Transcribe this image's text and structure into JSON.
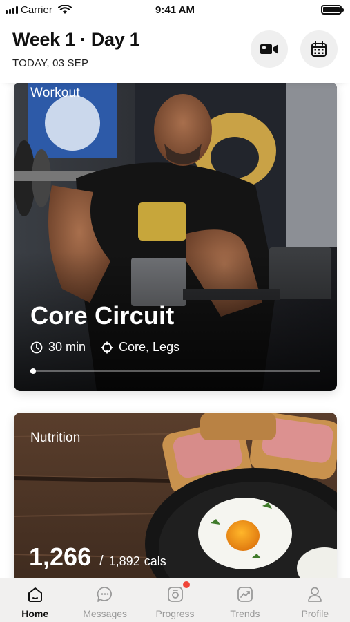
{
  "status_bar": {
    "carrier": "Carrier",
    "time": "9:41 AM"
  },
  "header": {
    "title": "Week 1 · Day 1",
    "date": "TODAY, 03 SEP",
    "video_button_icon": "video-camera-icon",
    "calendar_button_icon": "calendar-icon"
  },
  "workout_card": {
    "label": "Workout",
    "title": "Core Circuit",
    "duration": "30 min",
    "focus": "Core, Legs",
    "progress": 0.01
  },
  "nutrition_card": {
    "label": "Nutrition",
    "calories": "1,266",
    "separator": "/",
    "goal": "1,892",
    "unit": "cals"
  },
  "tabs": [
    {
      "label": "Home",
      "icon": "home-icon",
      "active": true
    },
    {
      "label": "Messages",
      "icon": "chat-bubble-icon",
      "active": false
    },
    {
      "label": "Progress",
      "icon": "camera-icon",
      "active": false,
      "badge": true
    },
    {
      "label": "Trends",
      "icon": "trend-chart-icon",
      "active": false
    },
    {
      "label": "Profile",
      "icon": "user-icon",
      "active": false
    }
  ],
  "colors": {
    "badge": "#f04438",
    "tab_active": "#111111",
    "tab_inactive": "#9a9a9a"
  }
}
